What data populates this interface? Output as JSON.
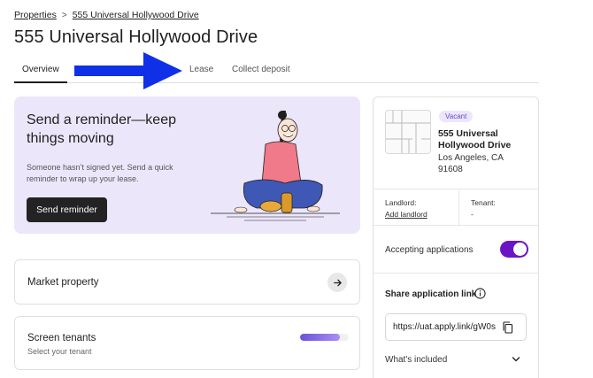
{
  "breadcrumb": {
    "parent": "Properties",
    "separator": ">",
    "current": "555 Universal Hollywood Drive"
  },
  "page_title": "555 Universal Hollywood Drive",
  "tabs": [
    {
      "label": "Overview",
      "active": true
    },
    {
      "label": "Lease",
      "active": false
    },
    {
      "label": "Collect deposit",
      "active": false
    }
  ],
  "annotation": {
    "arrow_color": "#1030e8",
    "icon": "arrow-right-icon"
  },
  "reminder": {
    "title": "Send a reminder—keep things moving",
    "text": "Someone hasn’t signed yet. Send a quick reminder to wrap up your lease.",
    "button_label": "Send reminder",
    "background_color": "#ece6fb"
  },
  "market_card": {
    "title": "Market property",
    "icon": "arrow-right-icon"
  },
  "screen_card": {
    "title": "Screen tenants",
    "subtitle": "Select your tenant",
    "progress_percent": 82
  },
  "property": {
    "status_badge": "Vacant",
    "name": "555 Universal Hollywood Drive",
    "address": "Los Angeles, CA 91608",
    "landlord_label": "Landlord:",
    "landlord_value": "Add landlord",
    "tenant_label": "Tenant:",
    "tenant_value": "-",
    "accepting_label": "Accepting applications",
    "accepting_enabled": true,
    "share_label": "Share application link",
    "share_link": "https://uat.apply.link/gW0s",
    "whats_included": "What's included"
  },
  "colors": {
    "accent": "#6a16c7",
    "badge_text": "#6b48c8",
    "dark_button": "#232323"
  }
}
